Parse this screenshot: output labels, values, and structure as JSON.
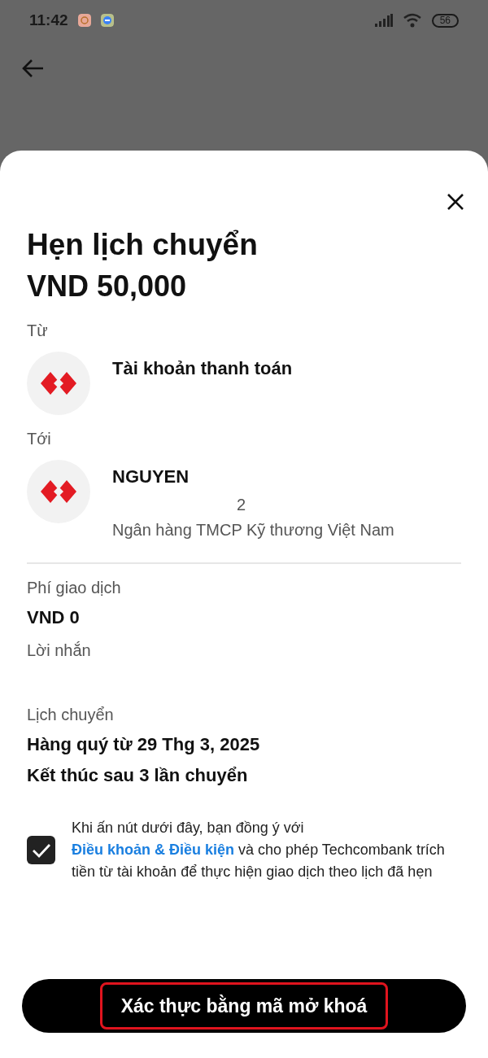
{
  "status_bar": {
    "time": "11:42",
    "battery": "56"
  },
  "sheet": {
    "title": "Hẹn lịch chuyển",
    "amount": "VND 50,000",
    "from": {
      "label": "Từ",
      "name": "Tài khoản thanh toán"
    },
    "to": {
      "label": "Tới",
      "name": "NGUYEN",
      "account": "2",
      "bank": "Ngân hàng TMCP Kỹ thương Việt Nam"
    },
    "details": [
      {
        "label": "Phí giao dịch",
        "values": [
          "VND 0"
        ]
      },
      {
        "label": "Lời nhắn"
      },
      {
        "label": "Lịch chuyển",
        "values": [
          "Hàng quý từ 29 Thg 3, 2025",
          "Kết thúc sau 3 lần chuyển"
        ]
      }
    ],
    "consent": {
      "checked": true,
      "text_before": "Khi ấn nút dưới đây, bạn đồng ý với",
      "link": "Điều khoản & Điều kiện",
      "text_after": "và cho phép Techcombank trích tiền từ tài khoản để thực hiện giao dịch theo lịch đã hẹn"
    },
    "confirm_button": "Xác thực bằng mã mở khoá"
  }
}
